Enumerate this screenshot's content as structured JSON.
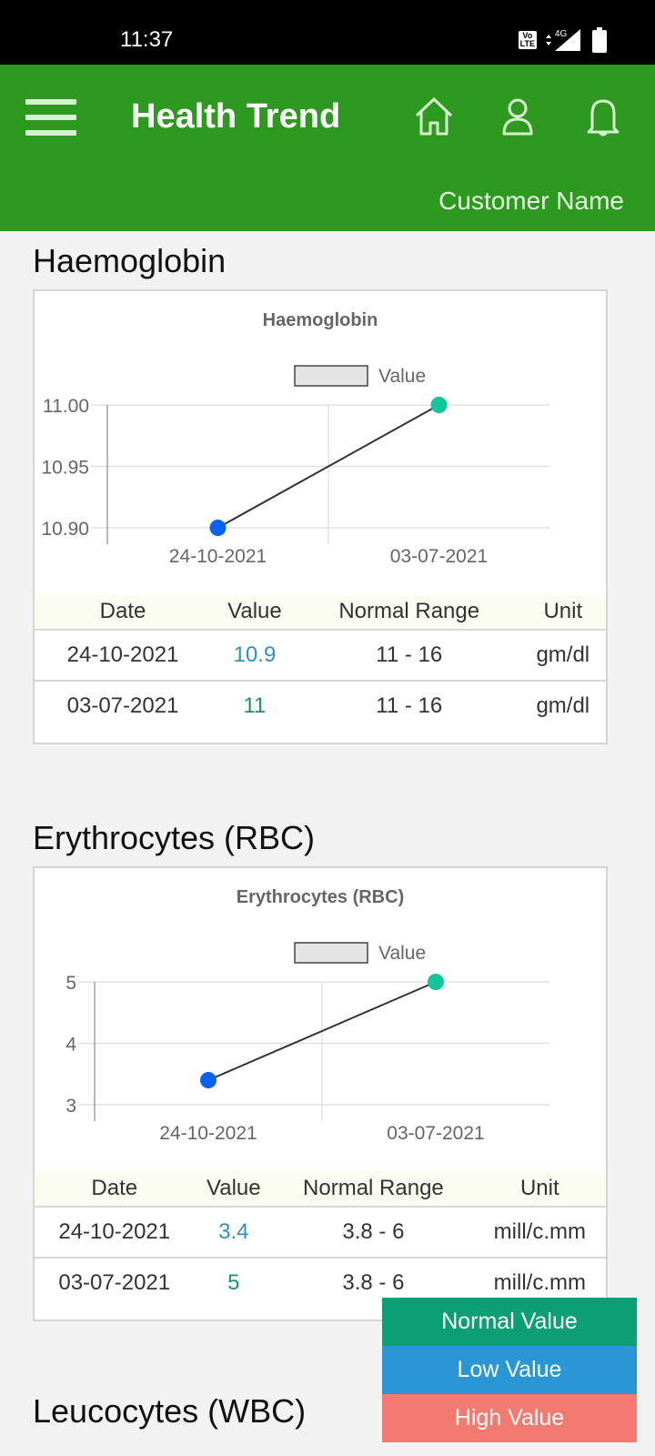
{
  "status_bar": {
    "time": "11:37",
    "network": "4G",
    "volte": "Vo LTE"
  },
  "app_bar": {
    "title": "Health Trend",
    "customer_name": "Customer  Name",
    "icons": [
      "menu-icon",
      "home-icon",
      "user-icon",
      "bell-icon"
    ]
  },
  "colors": {
    "brand": "#2d9a1f",
    "normal": "#0c9e74",
    "low": "#2b96d6",
    "high": "#f37a70",
    "point_low": "#0a63f0",
    "point_normal": "#12c59a"
  },
  "sections": [
    {
      "title": "Haemoglobin",
      "table": {
        "headers": [
          "Date",
          "Value",
          "Normal Range",
          "Unit"
        ],
        "rows": [
          {
            "date": "24-10-2021",
            "value": "10.9",
            "range": "11 - 16",
            "unit": "gm/dl",
            "status": "low"
          },
          {
            "date": "03-07-2021",
            "value": "11",
            "range": "11 - 16",
            "unit": "gm/dl",
            "status": "normal"
          }
        ]
      }
    },
    {
      "title": "Erythrocytes (RBC)",
      "table": {
        "headers": [
          "Date",
          "Value",
          "Normal Range",
          "Unit"
        ],
        "rows": [
          {
            "date": "24-10-2021",
            "value": "3.4",
            "range": "3.8 - 6",
            "unit": "mill/c.mm",
            "status": "low"
          },
          {
            "date": "03-07-2021",
            "value": "5",
            "range": "3.8 - 6",
            "unit": "mill/c.mm",
            "status": "normal"
          }
        ]
      }
    },
    {
      "title": "Leucocytes (WBC)"
    }
  ],
  "chart_data": [
    {
      "type": "line",
      "title": "Haemoglobin",
      "categories": [
        "24-10-2021",
        "03-07-2021"
      ],
      "series": [
        {
          "name": "Value",
          "values": [
            10.9,
            11
          ]
        }
      ],
      "point_status": [
        "low",
        "normal"
      ],
      "yticks": [
        "11.00",
        "10.95",
        "10.90"
      ],
      "ylim": [
        10.9,
        11.0
      ],
      "xlabel": "",
      "ylabel": "",
      "grid": true,
      "legend": "top"
    },
    {
      "type": "line",
      "title": "Erythrocytes (RBC)",
      "categories": [
        "24-10-2021",
        "03-07-2021"
      ],
      "series": [
        {
          "name": "Value",
          "values": [
            3.4,
            5
          ]
        }
      ],
      "point_status": [
        "low",
        "normal"
      ],
      "yticks": [
        "5",
        "4",
        "3"
      ],
      "ylim": [
        3,
        5
      ],
      "xlabel": "",
      "ylabel": "",
      "grid": true,
      "legend": "top"
    }
  ],
  "value_legend": [
    {
      "label": "Normal Value",
      "status": "normal"
    },
    {
      "label": "Low Value",
      "status": "low"
    },
    {
      "label": "High Value",
      "status": "high"
    }
  ]
}
